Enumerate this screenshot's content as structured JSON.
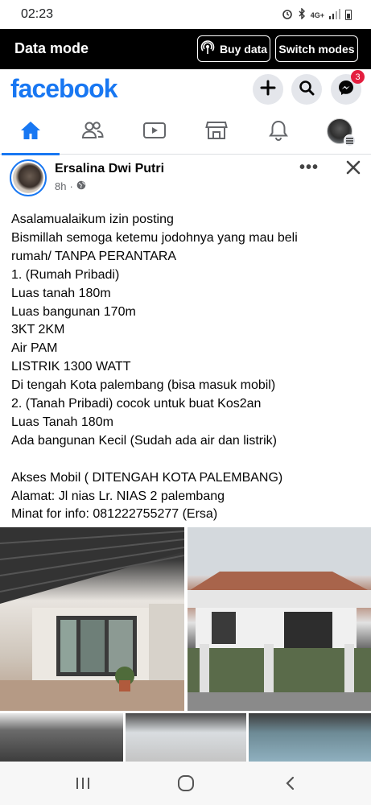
{
  "status_bar": {
    "time": "02:23",
    "network": "4G+"
  },
  "data_mode": {
    "title": "Data mode",
    "buy_data_label": "Buy data",
    "switch_modes_label": "Switch modes"
  },
  "header": {
    "logo": "facebook",
    "messenger_badge": "3",
    "brand_color": "#1877f2"
  },
  "nav_tabs": [
    {
      "name": "home",
      "icon": "home-icon",
      "active": true
    },
    {
      "name": "friends",
      "icon": "friends-icon",
      "active": false
    },
    {
      "name": "watch",
      "icon": "video-icon",
      "active": false
    },
    {
      "name": "marketplace",
      "icon": "store-icon",
      "active": false
    },
    {
      "name": "notifications",
      "icon": "bell-icon",
      "active": false
    },
    {
      "name": "menu",
      "icon": "profile-menu-icon",
      "active": false
    }
  ],
  "post": {
    "author": "Ersalina Dwi Putri",
    "time": "8h",
    "privacy_icon": "globe-icon",
    "lines": [
      "Asalamualaikum izin posting",
      "Bismillah semoga ketemu jodohnya yang mau beli",
      "rumah/ TANPA PERANTARA",
      "1. (Rumah Pribadi)",
      "Luas tanah 180m",
      "Luas bangunan 170m",
      "3KT 2KM",
      "Air PAM",
      "LISTRIK 1300 WATT",
      "Di tengah Kota palembang (bisa masuk mobil)",
      "2. (Tanah Pribadi) cocok untuk buat Kos2an",
      "Luas Tanah 180m",
      "Ada bangunan Kecil (Sudah ada air dan listrik)",
      "",
      "Akses Mobil ( DITENGAH KOTA PALEMBANG)",
      "Alamat: Jl nias Lr. NIAS 2 palembang",
      "Minat for info: 081222755277 (Ersa)"
    ]
  }
}
